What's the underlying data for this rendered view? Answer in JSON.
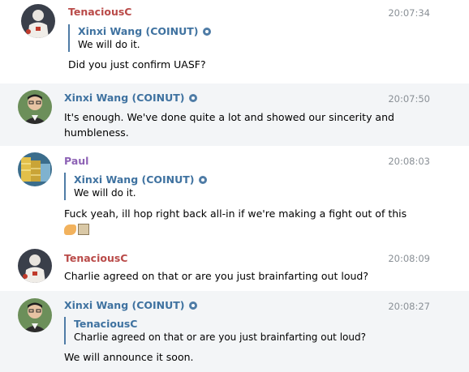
{
  "colors": {
    "author_red": "#b94a48",
    "author_blue": "#3f72a0",
    "author_purple": "#8d62b5",
    "timestamp": "#8a9096",
    "reply_bar": "#4f7ca6",
    "highlight_bg": "#f3f5f7"
  },
  "messages": [
    {
      "author": "TenaciousC",
      "time": "20:07:34",
      "reply": {
        "author": "Xinxi Wang (COINUT)",
        "text": "We will do it."
      },
      "text": "Did you just confirm UASF?"
    },
    {
      "author": "Xinxi Wang (COINUT)",
      "time": "20:07:50",
      "text_line1": "It's enough. We've done quite a lot and showed our sincerity and",
      "text_line2": "humbleness."
    },
    {
      "author": "Paul",
      "time": "20:08:03",
      "reply": {
        "author": "Xinxi Wang (COINUT)",
        "text": "We will do it."
      },
      "text": "Fuck yeah, ill hop right back all-in if we're making a fight out of this",
      "emojis": [
        "flexed-biceps-icon",
        "cookie-icon"
      ]
    },
    {
      "author": "TenaciousC",
      "time": "20:08:09",
      "text": "Charlie agreed on that or are you just brainfarting out loud?"
    },
    {
      "author": "Xinxi Wang (COINUT)",
      "time": "20:08:27",
      "reply": {
        "author": "TenaciousC",
        "text": "Charlie agreed on that or are you just brainfarting out loud?"
      },
      "text": "We will announce it soon."
    }
  ]
}
